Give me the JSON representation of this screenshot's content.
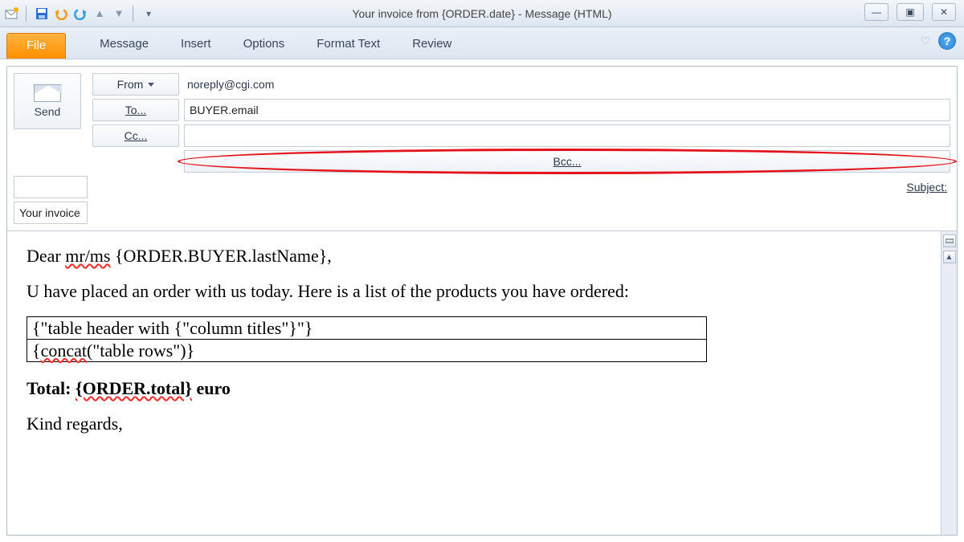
{
  "window": {
    "title": "Your invoice from {ORDER.date}  -  Message (HTML)"
  },
  "qat_icons": [
    "mail-new-icon",
    "save-icon",
    "undo-icon",
    "redo-icon",
    "prev-icon",
    "next-icon",
    "customize-icon"
  ],
  "ribbon": {
    "file": "File",
    "tabs": [
      "Message",
      "Insert",
      "Options",
      "Format Text",
      "Review"
    ]
  },
  "compose": {
    "send": "Send",
    "from_label": "From",
    "from_value": "noreply@cgi.com",
    "to_label": "To...",
    "to_value": "BUYER.email",
    "cc_label": "Cc...",
    "cc_value": "",
    "bcc_label": "Bcc...",
    "bcc_value": "",
    "subject_label": "Subject:",
    "subject_value": "Your invoice from {ORDER.date}"
  },
  "body": {
    "greeting_prefix": "Dear ",
    "greeting_mrms": "mr/ms",
    "greeting_name": " {ORDER.BUYER.lastName},",
    "line2": "U have placed an order with us today. Here is a list of the products you have ordered:",
    "table_row1": "{\"table header with {\"column titles\"}\"}",
    "table_row2": "{concat(\"table rows\")}",
    "total_prefix": "Total: ",
    "total_value": "{ORDER.total}",
    "total_suffix": " euro",
    "signoff": "Kind regards,"
  },
  "help": "?"
}
